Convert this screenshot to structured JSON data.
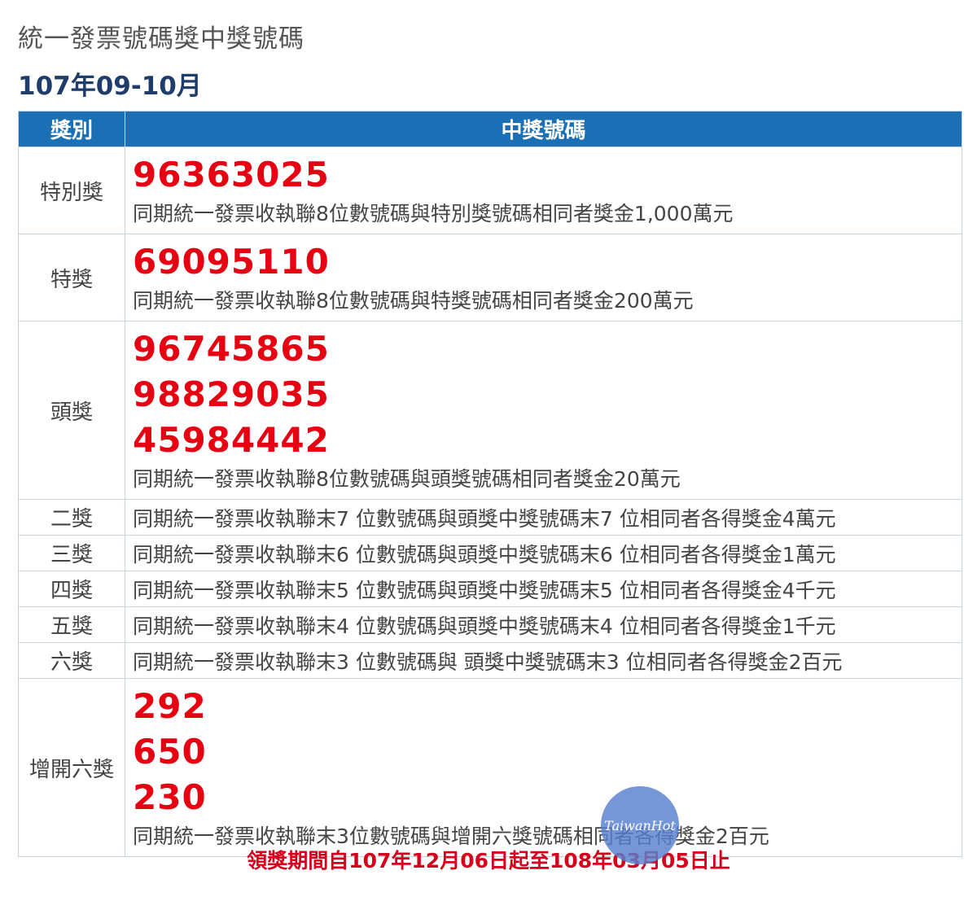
{
  "page": {
    "title": "統一發票號碼獎中獎號碼",
    "period": "107年09-10月"
  },
  "table": {
    "headers": {
      "category": "獎別",
      "numbers": "中獎號碼"
    },
    "special": {
      "label": "特別獎",
      "numbers": [
        "96363025"
      ],
      "desc": "同期統一發票收執聯8位數號碼與特別獎號碼相同者獎金1,000萬元"
    },
    "grand": {
      "label": "特獎",
      "numbers": [
        "69095110"
      ],
      "desc": "同期統一發票收執聯8位數號碼與特獎號碼相同者獎金200萬元"
    },
    "first": {
      "label": "頭獎",
      "numbers": [
        "96745865",
        "98829035",
        "45984442"
      ],
      "desc": "同期統一發票收執聯8位數號碼與頭獎號碼相同者獎金20萬元"
    },
    "second": {
      "label": "二獎",
      "desc": "同期統一發票收執聯末7 位數號碼與頭獎中獎號碼末7 位相同者各得獎金4萬元"
    },
    "third": {
      "label": "三獎",
      "desc": "同期統一發票收執聯末6 位數號碼與頭獎中獎號碼末6 位相同者各得獎金1萬元"
    },
    "fourth": {
      "label": "四獎",
      "desc": "同期統一發票收執聯末5 位數號碼與頭獎中獎號碼末5 位相同者各得獎金4千元"
    },
    "fifth": {
      "label": "五獎",
      "desc": "同期統一發票收執聯末4 位數號碼與頭獎中獎號碼末4 位相同者各得獎金1千元"
    },
    "sixth": {
      "label": "六獎",
      "desc": "同期統一發票收執聯末3 位數號碼與 頭獎中獎號碼末3 位相同者各得獎金2百元"
    },
    "extra_sixth": {
      "label": "增開六獎",
      "numbers": [
        "292",
        "650",
        "230"
      ],
      "desc": "同期統一發票收執聯末3位數號碼與增開六獎號碼相同者各得獎金2百元"
    }
  },
  "footer": {
    "claim_period": "領獎期間自107年12月06日起至108年03月05日止"
  },
  "watermark": {
    "text": "TaiwanHot",
    "color": "#5880ce"
  },
  "colors": {
    "header_bg": "#1a6fb5",
    "winning_number": "#e60012",
    "footer_text": "#d6001c"
  }
}
